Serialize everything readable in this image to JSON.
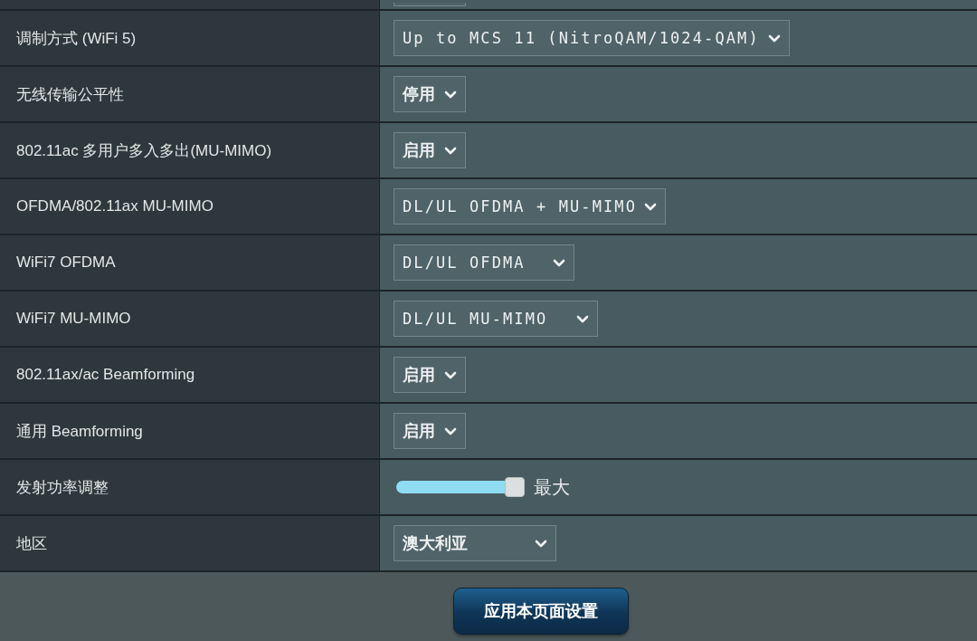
{
  "rows": [
    {
      "label": "调制方式 (WiFi 5)",
      "kind": "select",
      "value": "Up to MCS 11 (NitroQAM/1024-QAM)"
    },
    {
      "label": "无线传输公平性",
      "kind": "select",
      "value": "停用"
    },
    {
      "label": "802.11ac 多用户多入多出(MU-MIMO)",
      "kind": "select",
      "value": "启用"
    },
    {
      "label": "OFDMA/802.11ax MU-MIMO",
      "kind": "select",
      "value": "DL/UL OFDMA + MU-MIMO"
    },
    {
      "label": "WiFi7 OFDMA",
      "kind": "select",
      "value": "DL/UL OFDMA"
    },
    {
      "label": "WiFi7 MU-MIMO",
      "kind": "select",
      "value": "DL/UL MU-MIMO"
    },
    {
      "label": "802.11ax/ac Beamforming",
      "kind": "select",
      "value": "启用"
    },
    {
      "label": "通用 Beamforming",
      "kind": "select",
      "value": "启用"
    },
    {
      "label": "发射功率调整",
      "kind": "slider",
      "level": 1,
      "reading": "最大"
    },
    {
      "label": "地区",
      "kind": "select",
      "value": "澳大利亚"
    }
  ],
  "apply_button": {
    "label": "应用本页面设置"
  }
}
